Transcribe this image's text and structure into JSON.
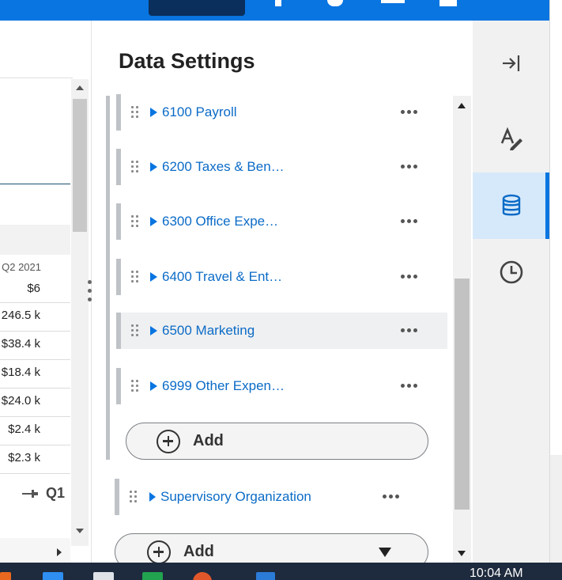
{
  "grid": {
    "column_header": "Q2 2021",
    "cells": [
      "$6",
      "246.5 k",
      "$38.4 k",
      "$18.4 k",
      "$24.0 k",
      "$2.4 k",
      "$2.3 k"
    ],
    "pinned_label": "Q1"
  },
  "settings": {
    "title": "Data Settings",
    "items": [
      {
        "label": "6100 Payroll"
      },
      {
        "label": "6200 Taxes & Ben…"
      },
      {
        "label": "6300 Office Expe…"
      },
      {
        "label": "6400 Travel & Ent…"
      },
      {
        "label": "6500 Marketing"
      },
      {
        "label": "6999 Other Expen…"
      }
    ],
    "add_label": "Add",
    "supervisory_label": "Supervisory Organization",
    "add2_label": "Add"
  },
  "rail": {
    "items": [
      {
        "icon": "collapse-panel-icon"
      },
      {
        "icon": "format-text-icon"
      },
      {
        "icon": "database-icon",
        "active": true
      },
      {
        "icon": "history-clock-icon"
      }
    ]
  },
  "taskbar": {
    "clock": "10:04 AM"
  },
  "colors": {
    "brand_blue": "#0875e1",
    "link_blue": "#0b6bc7",
    "active_rail_bg": "#d6e9fb"
  }
}
